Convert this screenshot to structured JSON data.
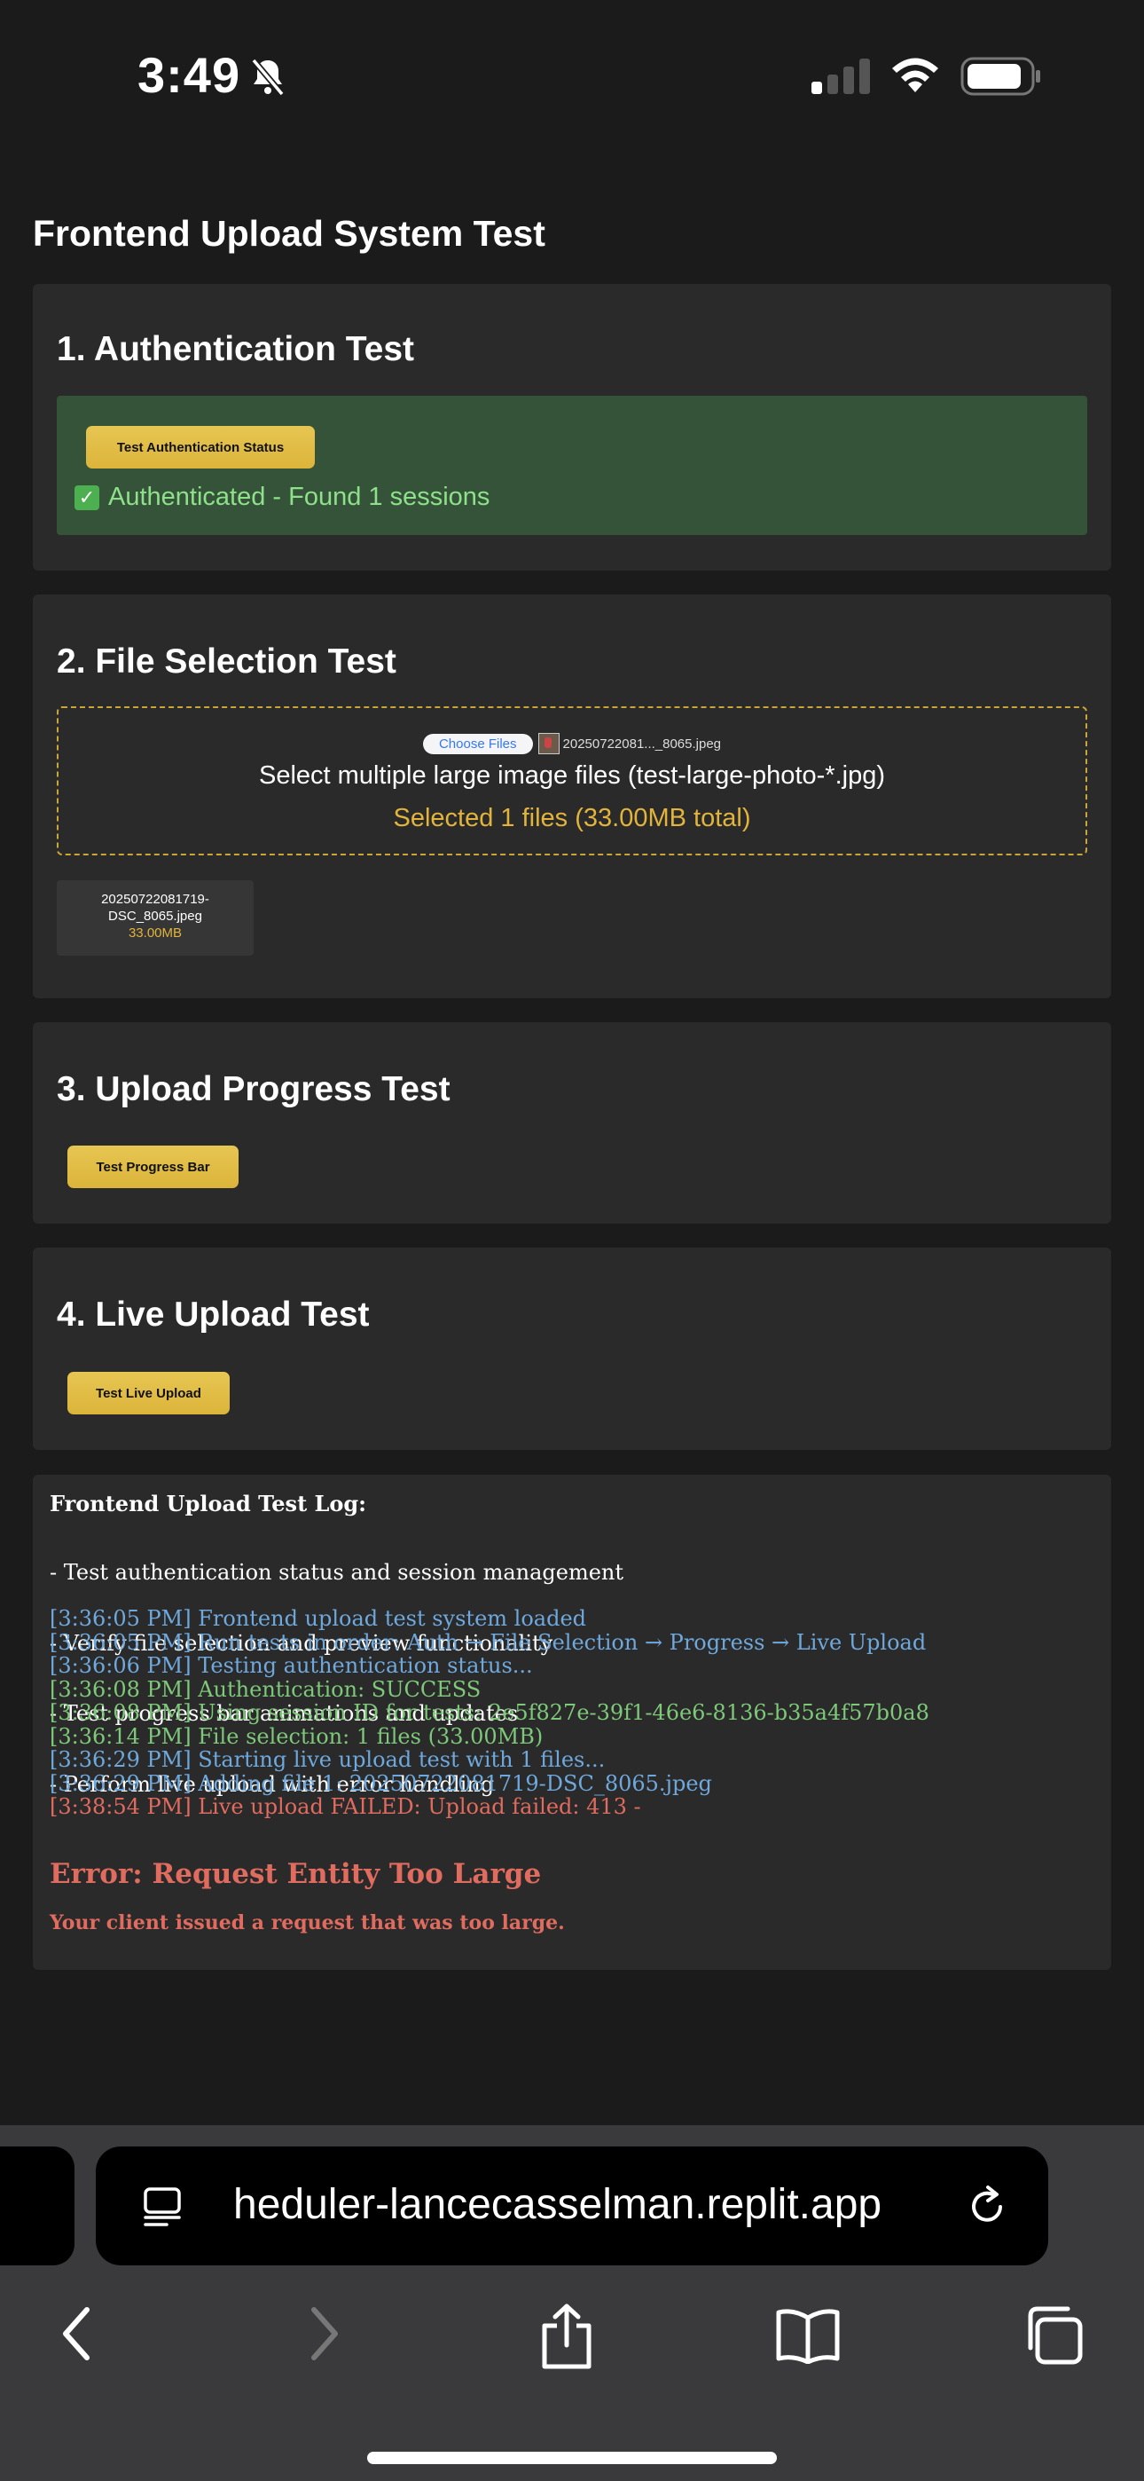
{
  "status_bar": {
    "time": "3:49"
  },
  "page": {
    "title": "Frontend Upload System Test"
  },
  "auth": {
    "heading": "1. Authentication Test",
    "button_label": "Test Authentication Status",
    "status_icon": "✓",
    "status_text": "Authenticated - Found 1 sessions"
  },
  "file_selection": {
    "heading": "2. File Selection Test",
    "choose_label": "Choose Files",
    "chosen_file": "20250722081..._8065.jpeg",
    "drop_text": "Select multiple large image files (test-large-photo-*.jpg)",
    "selected_text": "Selected 1 files (33.00MB total)",
    "preview": {
      "name_line1": "20250722081719-",
      "name_line2": "DSC_8065.jpeg",
      "size": "33.00MB"
    }
  },
  "progress": {
    "heading": "3. Upload Progress Test",
    "button_label": "Test Progress Bar"
  },
  "live": {
    "heading": "4. Live Upload Test",
    "button_label": "Test Live Upload"
  },
  "log": {
    "title": "Frontend Upload Test Log:",
    "intro": [
      "- Test authentication status and session management",
      "- Verify file selection and preview functionality",
      "- Test progress bar animations and updates",
      "- Perform live upload with error handling"
    ],
    "lines": [
      {
        "text": "[3:36:05 PM] Frontend upload test system loaded",
        "level": "info"
      },
      {
        "text": "[3:36:05 PM] Run tests in order: Auth → File Selection → Progress → Live Upload",
        "level": "info"
      },
      {
        "text": "[3:36:06 PM] Testing authentication status...",
        "level": "info"
      },
      {
        "text": "[3:36:08 PM] Authentication: SUCCESS",
        "level": "success"
      },
      {
        "text": "[3:36:08 PM] Using session ID for tests: 2e5f827e-39f1-46e6-8136-b35a4f57b0a8",
        "level": "success"
      },
      {
        "text": "[3:36:14 PM] File selection: 1 files (33.00MB)",
        "level": "success"
      },
      {
        "text": "[3:36:29 PM] Starting live upload test with 1 files...",
        "level": "info"
      },
      {
        "text": "[3:36:29 PM] Adding file 1: 20250722081719-DSC_8065.jpeg",
        "level": "info"
      },
      {
        "text": "[3:38:54 PM] Live upload FAILED: Upload failed: 413 -",
        "level": "error"
      }
    ],
    "error_title": "Error: Request Entity Too Large",
    "error_message": "Your client issued a request that was too large."
  },
  "browser": {
    "url": "heduler-lancecasselman.replit.app"
  },
  "colors": {
    "accent_yellow": "#dcb43a",
    "success_green": "#7ec87a",
    "info_blue": "#6fa8dc",
    "error_red": "#e06b5f"
  }
}
